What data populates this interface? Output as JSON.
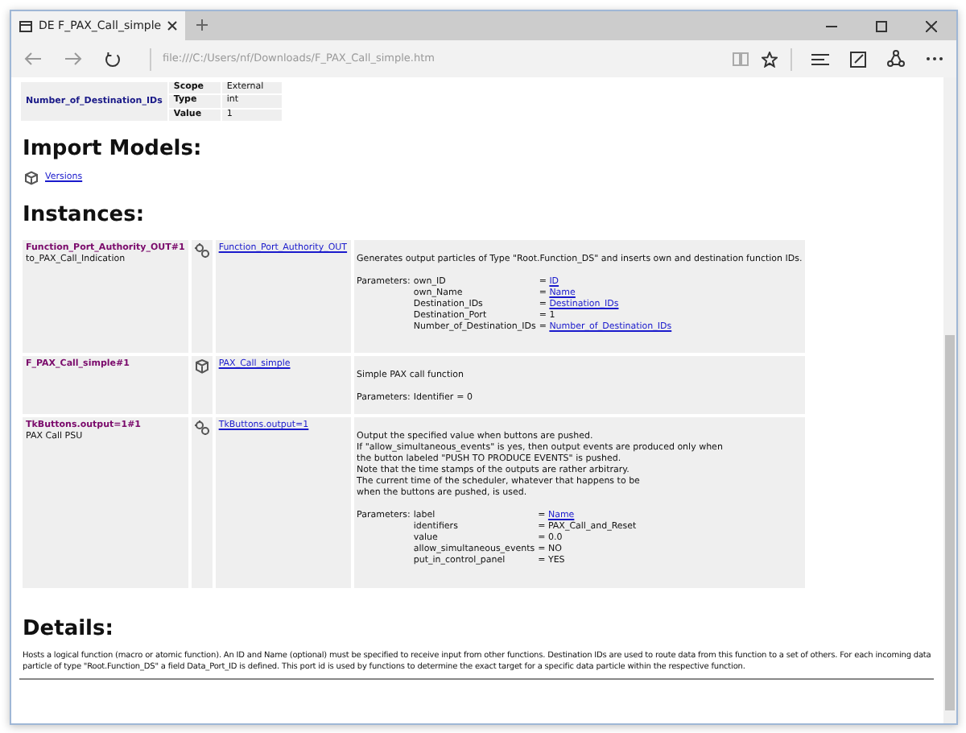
{
  "window": {
    "tab_title": "DE F_PAX_Call_simple",
    "address": "file:///C:/Users/nf/Downloads/F_PAX_Call_simple.htm"
  },
  "variable": {
    "name": "Number_of_Destination_IDs",
    "properties": [
      {
        "label": "Scope",
        "value": "External"
      },
      {
        "label": "Type",
        "value": "int"
      },
      {
        "label": "Value",
        "value": "1"
      }
    ]
  },
  "import_models": {
    "heading": "Import Models:",
    "items": [
      {
        "link": "Versions"
      }
    ]
  },
  "instances": {
    "heading": "Instances:",
    "rows": [
      {
        "name": "Function_Port_Authority_OUT#1",
        "subtitle": "to_PAX_Call_Indication",
        "kind": "atomic",
        "model": "Function_Port_Authority_OUT",
        "description": [
          "Generates output particles of Type \"Root.Function_DS\" and inserts own and destination function IDs."
        ],
        "params_label": "Parameters:",
        "params": [
          {
            "name": "own_ID",
            "sign": "=",
            "value": "ID",
            "kind": "link"
          },
          {
            "name": "own_Name",
            "sign": "=",
            "value": "Name",
            "kind": "link"
          },
          {
            "name": "Destination_IDs",
            "sign": "=",
            "value": "Destination_IDs",
            "kind": "link"
          },
          {
            "name": "Destination_Port",
            "sign": "=",
            "value": "1",
            "kind": "text"
          },
          {
            "name": "Number_of_Destination_IDs",
            "sign": "=",
            "value": "Number_of_Destination_IDs",
            "kind": "link"
          }
        ]
      },
      {
        "name": "F_PAX_Call_simple#1",
        "kind": "coupled",
        "model": "PAX_Call_simple",
        "description": [
          "Simple PAX call function"
        ],
        "params_label": "Parameters:",
        "params": [
          {
            "name": "Identifier",
            "sign": "=",
            "value": "0",
            "kind": "text"
          }
        ]
      },
      {
        "name": "TkButtons.output=1#1",
        "subtitle": "PAX Call PSU",
        "kind": "atomic",
        "model": "TkButtons.output=1",
        "description": [
          "Output the specified value when buttons are pushed.",
          "If \"allow_simultaneous_events\" is yes, then output events are produced only when",
          "the button labeled \"PUSH TO PRODUCE EVENTS\" is pushed.",
          "Note that the time stamps of the outputs are rather arbitrary.",
          "The current time of the scheduler, whatever that happens to be",
          "when the buttons are pushed, is used."
        ],
        "params_label": "Parameters:",
        "params": [
          {
            "name": "label",
            "sign": "=",
            "value": "Name",
            "kind": "link"
          },
          {
            "name": "identifiers",
            "sign": "=",
            "value": "PAX_Call_and_Reset",
            "kind": "text"
          },
          {
            "name": "value",
            "sign": "=",
            "value": "0.0",
            "kind": "text"
          },
          {
            "name": "allow_simultaneous_events",
            "sign": "=",
            "value": "NO",
            "kind": "text"
          },
          {
            "name": "put_in_control_panel",
            "sign": "=",
            "value": "YES",
            "kind": "text"
          }
        ]
      }
    ]
  },
  "details": {
    "heading": "Details:",
    "text": "Hosts a logical function (macro or atomic function). An ID and Name (optional) must be specified to receive input from other functions. Destination IDs are used to route data from this function to a set of others. For each incoming data particle of type \"Root.Function_DS\" a field Data_Port_ID is defined. This port id is used by functions to determine the exact target for a specific data particle within the respective function."
  }
}
